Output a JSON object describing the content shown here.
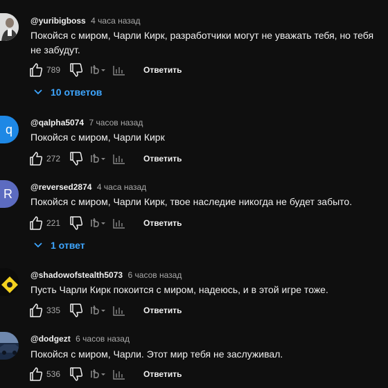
{
  "labels": {
    "reply": "Ответить"
  },
  "comments": [
    {
      "handle": "@yuribigboss",
      "time": "4 часа назад",
      "text": "Покойся с миром, Чарли Кирк, разработчики могут не уважать тебя, но тебя не забудут.",
      "likes": "789",
      "replies_label": "10 ответов",
      "avatar": {
        "type": "photo",
        "colors": [
          "#d9d9d9",
          "#404040"
        ]
      }
    },
    {
      "handle": "@qalpha5074",
      "time": "7 часов назад",
      "text": "Покойся с миром, Чарли Кирк",
      "likes": "272",
      "avatar": {
        "type": "letter",
        "letter": "q",
        "color": "#1e88e5"
      }
    },
    {
      "handle": "@reversed2874",
      "time": "4 часа назад",
      "text": "Покойся с миром, Чарли Кирк, твое наследие никогда не будет забыто.",
      "likes": "221",
      "replies_label": "1 ответ",
      "avatar": {
        "type": "letter",
        "letter": "R",
        "color": "#5c6bc0"
      }
    },
    {
      "handle": "@shadowofstealth5073",
      "time": "6 часов назад",
      "text": "Пусть Чарли Кирк покоится с миром, надеюсь, и в этой игре тоже.",
      "likes": "335",
      "avatar": {
        "type": "photo",
        "colors": [
          "#0a0a0a",
          "#f4d21f"
        ]
      }
    },
    {
      "handle": "@dodgezt",
      "time": "6 часов назад",
      "text": "Покойся с миром, Чарли. Этот мир тебя не заслуживал.",
      "likes": "536",
      "avatar": {
        "type": "photo",
        "colors": [
          "#1a2a44",
          "#5a7398"
        ]
      }
    }
  ],
  "icons": {
    "like": "thumbs-up-icon",
    "dislike": "thumbs-down-icon",
    "ai": "ai-sparkle-icon",
    "stats": "bar-chart-icon",
    "chevron": "chevron-down-icon"
  },
  "colors": {
    "background": "#0f0f0f",
    "link": "#3ea6ff",
    "muted": "#aaaaaa",
    "text": "#f1f1f1"
  }
}
